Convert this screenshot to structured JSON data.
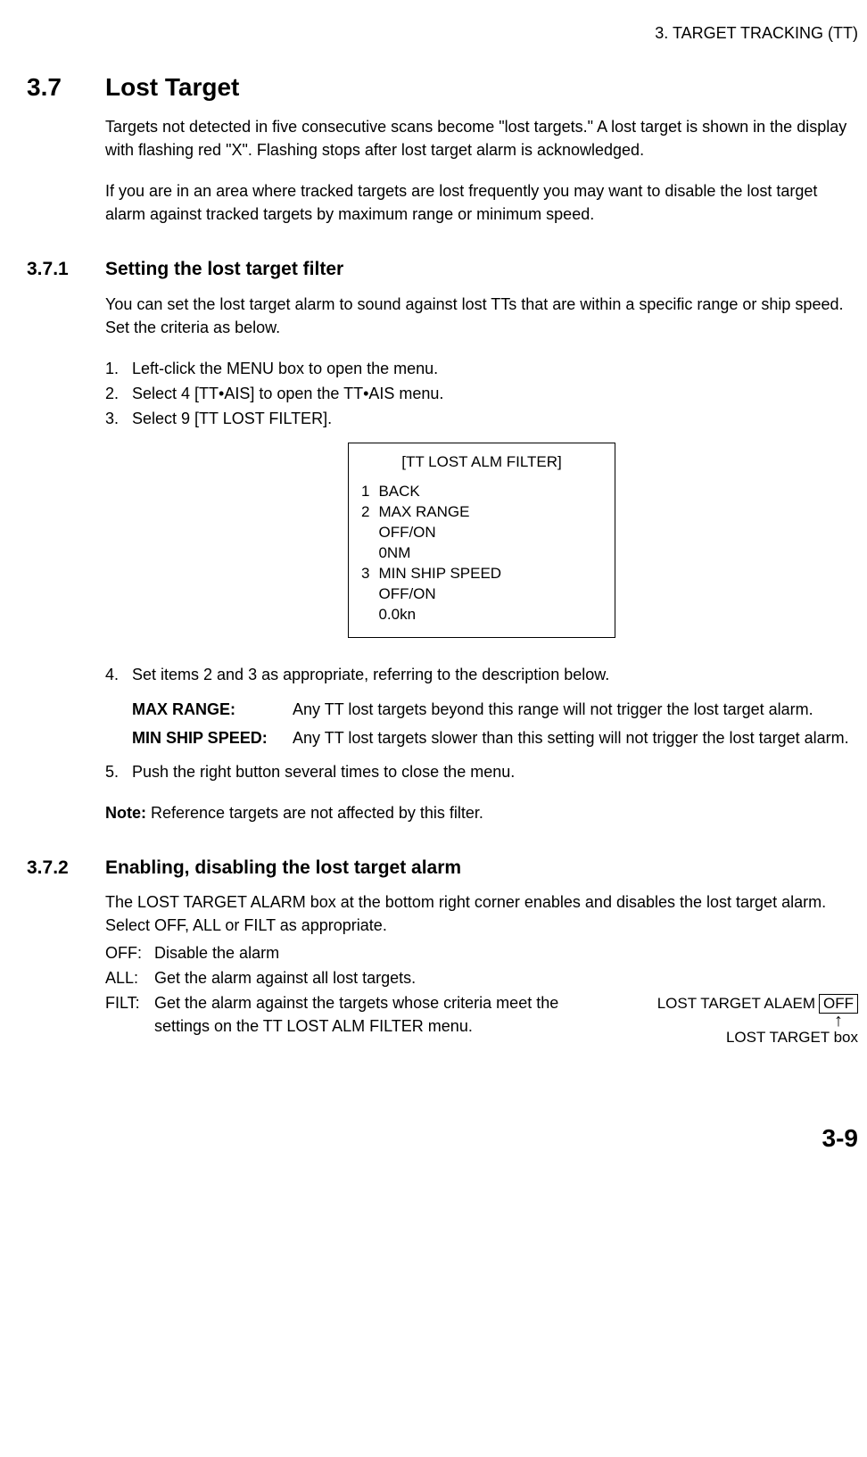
{
  "header": "3. TARGET TRACKING (TT)",
  "sec_num": "3.7",
  "sec_title": "Lost Target",
  "intro_p1": "Targets not detected in five consecutive scans become \"lost targets.\" A lost target is shown in the display with flashing red \"X\". Flashing stops after lost target alarm is acknowledged.",
  "intro_p2": "If you are in an area where tracked targets are lost frequently you may want to disable the lost target alarm against tracked targets by maximum range or minimum speed.",
  "sub1_num": "3.7.1",
  "sub1_title": "Setting the lost target filter",
  "sub1_p1": "You can set the lost target alarm to sound against lost TTs that are within a specific range or ship speed. Set the criteria as below.",
  "step1": "Left-click the MENU box to open the menu.",
  "step2": "Select 4 [TT•AIS] to open the TT•AIS menu.",
  "step3": "Select 9 [TT LOST FILTER].",
  "menu": {
    "title": "[TT LOST ALM FILTER]",
    "row1n": "1",
    "row1t": "BACK",
    "row2n": "2",
    "row2t": "MAX RANGE",
    "row2a": "OFF/ON",
    "row2b": "0NM",
    "row3n": "3",
    "row3t": "MIN SHIP SPEED",
    "row3a": "OFF/ON",
    "row3b": "0.0kn"
  },
  "step4": "Set items 2 and 3 as appropriate, referring to the description below.",
  "def1_term": "MAX RANGE:",
  "def1_desc": "Any TT lost targets beyond this range will not trigger the lost target alarm.",
  "def2_term": "MIN SHIP SPEED:",
  "def2_desc": "Any TT lost targets slower than this setting will not trigger the lost target alarm.",
  "step5": "Push the right button several times to close the menu.",
  "note_label": "Note:",
  "note_text": " Reference targets are not affected by this filter.",
  "sub2_num": "3.7.2",
  "sub2_title": "Enabling, disabling the lost target alarm",
  "sub2_p1": "The LOST TARGET ALARM box at the bottom right corner enables and disables the lost target alarm. Select OFF, ALL or FILT as appropriate.",
  "opt_off_k": "OFF:",
  "opt_off_v": "Disable the alarm",
  "opt_all_k": "ALL:",
  "opt_all_v": "Get the alarm against all lost targets.",
  "opt_filt_k": "FILT:",
  "opt_filt_v": "Get the alarm against the targets whose criteria meet the settings on the TT LOST ALM FILTER menu.",
  "lt_alarm_label": "LOST TARGET ALAEM",
  "lt_alarm_state": "OFF",
  "lt_box_label": "LOST TARGET box",
  "page_num": "3-9"
}
